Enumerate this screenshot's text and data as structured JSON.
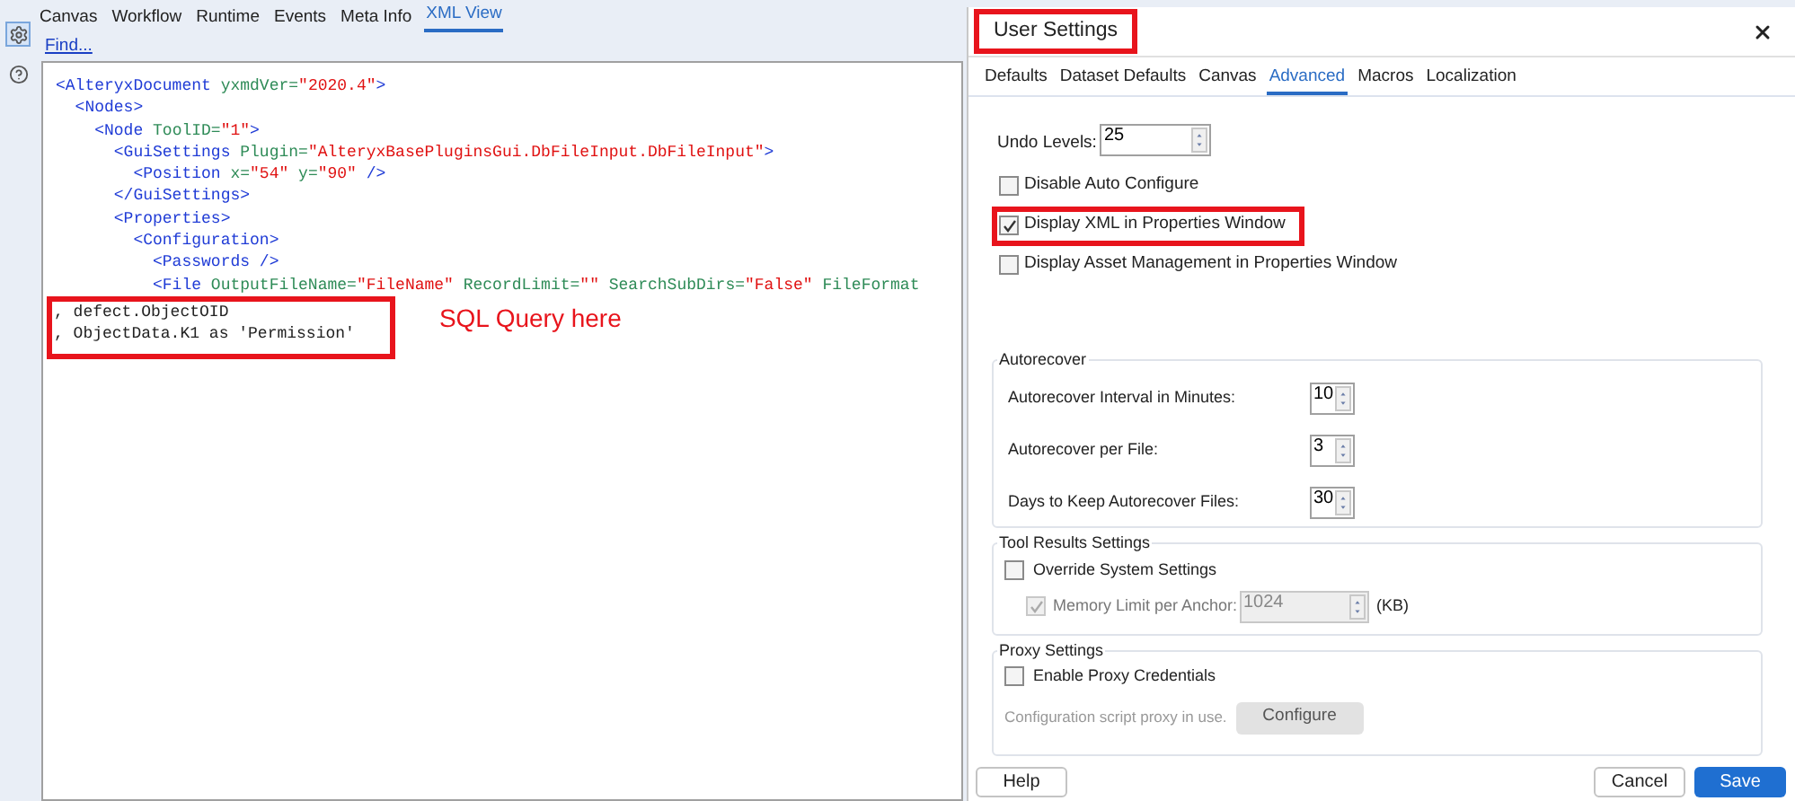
{
  "sidebar": {
    "icons": [
      {
        "kind": "gear",
        "selected": true
      },
      {
        "kind": "help",
        "selected": false
      }
    ]
  },
  "tabs": [
    {
      "label": "Canvas",
      "selected": false
    },
    {
      "label": "Workflow",
      "selected": false
    },
    {
      "label": "Runtime",
      "selected": false
    },
    {
      "label": "Events",
      "selected": false
    },
    {
      "label": "Meta Info",
      "selected": false
    },
    {
      "label": "XML View",
      "selected": true
    }
  ],
  "find_link": "Find...",
  "xml_lines": [
    {
      "segments": [
        {
          "kind": "tag",
          "text": "<AlteryxDocument "
        },
        {
          "kind": "attr",
          "text": "yxmdVer="
        },
        {
          "kind": "value",
          "text": "\"2020.4\""
        },
        {
          "kind": "tag",
          "text": ">"
        }
      ]
    },
    {
      "segments": [
        {
          "kind": "tag",
          "text": "  <Nodes>"
        }
      ]
    },
    {
      "segments": [
        {
          "kind": "tag",
          "text": "    <Node "
        },
        {
          "kind": "attr",
          "text": "ToolID="
        },
        {
          "kind": "value",
          "text": "\"1\""
        },
        {
          "kind": "tag",
          "text": ">"
        }
      ]
    },
    {
      "segments": [
        {
          "kind": "tag",
          "text": "      <GuiSettings "
        },
        {
          "kind": "attr",
          "text": "Plugin="
        },
        {
          "kind": "value",
          "text": "\"AlteryxBasePluginsGui.DbFileInput.DbFileInput\""
        },
        {
          "kind": "tag",
          "text": ">"
        }
      ]
    },
    {
      "segments": [
        {
          "kind": "tag",
          "text": "        <Position "
        },
        {
          "kind": "attr",
          "text": "x="
        },
        {
          "kind": "value",
          "text": "\"54\""
        },
        {
          "kind": "attr",
          "text": " y="
        },
        {
          "kind": "value",
          "text": "\"90\""
        },
        {
          "kind": "tag",
          "text": " />"
        }
      ]
    },
    {
      "segments": [
        {
          "kind": "tag",
          "text": "      </GuiSettings>"
        }
      ]
    },
    {
      "segments": [
        {
          "kind": "tag",
          "text": "      <Properties>"
        }
      ]
    },
    {
      "segments": [
        {
          "kind": "tag",
          "text": "        <Configuration>"
        }
      ]
    },
    {
      "segments": [
        {
          "kind": "tag",
          "text": "          <Passwords />"
        }
      ]
    },
    {
      "segments": [
        {
          "kind": "tag",
          "text": "          <File "
        },
        {
          "kind": "attr",
          "text": "OutputFileName="
        },
        {
          "kind": "value",
          "text": "\"FileName\""
        },
        {
          "kind": "attr",
          "text": " RecordLimit="
        },
        {
          "kind": "value",
          "text": "\"\""
        },
        {
          "kind": "attr",
          "text": " SearchSubDirs="
        },
        {
          "kind": "value",
          "text": "\"False\""
        },
        {
          "kind": "attr",
          "text": " FileFormat"
        }
      ]
    }
  ],
  "sql_lines": [
    ", defect.ObjectOID",
    ", ObjectData.K1 as 'Permission'"
  ],
  "annotation": "SQL Query here",
  "dialog": {
    "title": "User Settings",
    "tabs": [
      {
        "label": "Defaults",
        "selected": false
      },
      {
        "label": "Dataset Defaults",
        "selected": false
      },
      {
        "label": "Canvas",
        "selected": false
      },
      {
        "label": "Advanced",
        "selected": true
      },
      {
        "label": "Macros",
        "selected": false
      },
      {
        "label": "Localization",
        "selected": false
      }
    ],
    "undo": {
      "label": "Undo Levels:",
      "value": "25"
    },
    "checkboxes": [
      {
        "label": "Disable Auto Configure",
        "checked": false,
        "highlighted": false
      },
      {
        "label": "Display XML in Properties Window",
        "checked": true,
        "highlighted": true
      },
      {
        "label": "Display Asset Management in Properties Window",
        "checked": false,
        "highlighted": false
      }
    ],
    "autorecover": {
      "title": "Autorecover",
      "fields": [
        {
          "label": "Autorecover Interval in Minutes:",
          "value": "10"
        },
        {
          "label": "Autorecover per File:",
          "value": "3"
        },
        {
          "label": "Days to Keep Autorecover Files:",
          "value": "30"
        }
      ]
    },
    "tool_results": {
      "title": "Tool Results Settings",
      "override": {
        "label": "Override System Settings",
        "checked": false
      },
      "memory": {
        "label": "Memory Limit per Anchor:",
        "checked": true,
        "disabled": true,
        "value": "1024",
        "unit": "(KB)"
      }
    },
    "proxy": {
      "title": "Proxy Settings",
      "enable": {
        "label": "Enable Proxy Credentials",
        "checked": false
      },
      "note": "Configuration script proxy in use.",
      "button": {
        "label": "Configure",
        "disabled": true
      }
    },
    "buttons": [
      {
        "label": "Help",
        "kind": "secondary"
      },
      {
        "label": "Cancel",
        "kind": "secondary"
      },
      {
        "label": "Save",
        "kind": "primary"
      }
    ]
  }
}
